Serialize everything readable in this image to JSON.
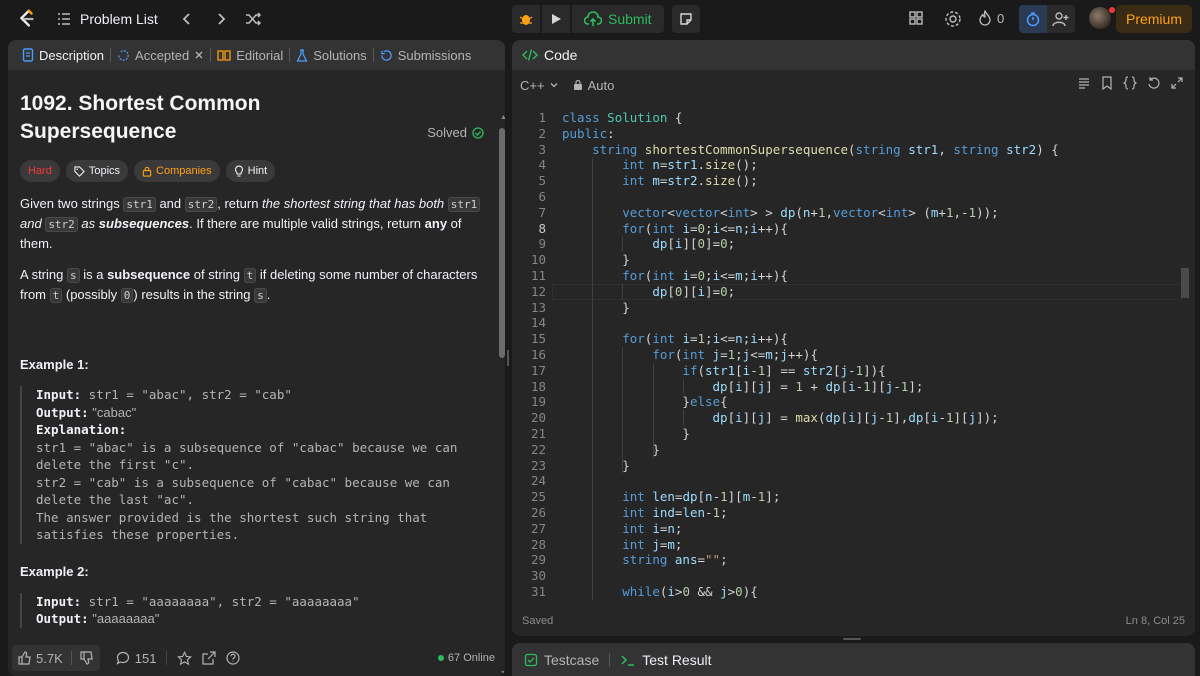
{
  "topbar": {
    "problem_list": "Problem List",
    "submit": "Submit",
    "streak": "0",
    "premium": "Premium"
  },
  "left_tabs": [
    "Description",
    "Accepted",
    "Editorial",
    "Solutions",
    "Submissions"
  ],
  "problem": {
    "title": "1092. Shortest Common Supersequence",
    "solved": "Solved",
    "tags": [
      "Hard",
      "Topics",
      "Companies",
      "Hint"
    ]
  },
  "description": {
    "p1_a": "Given two strings ",
    "p1_code1": "str1",
    "p1_b": " and ",
    "p1_code2": "str2",
    "p1_c": ", return ",
    "p1_em": "the shortest string that has both ",
    "p1_code3": "str1",
    "p1_em2": " and ",
    "p1_code4": "str2",
    "p1_em3": " as ",
    "p1_bold": "subsequences",
    "p1_d": ". If there are multiple valid strings, return ",
    "p1_any": "any",
    "p1_e": " of them.",
    "p2_a": "A string ",
    "p2_s": "s",
    "p2_b": " is a ",
    "p2_bold": "subsequence",
    "p2_c": " of string ",
    "p2_t": "t",
    "p2_d": " if deleting some number of characters from ",
    "p2_t2": "t",
    "p2_e": " (possibly ",
    "p2_zero": "0",
    "p2_f": ") results in the string ",
    "p2_s2": "s",
    "p2_g": "."
  },
  "example1": {
    "heading": "Example 1:",
    "input_label": "Input:",
    "input_value": " str1 = \"abac\", str2 = \"cab\"",
    "output_label": "Output:",
    "output_value": " \"cabac\"",
    "explanation_label": "Explanation:",
    "explanation": "str1 = \"abac\" is a subsequence of \"cabac\" because we can delete the first \"c\".\nstr2 = \"cab\" is a subsequence of \"cabac\" because we can delete the last \"ac\".\nThe answer provided is the shortest such string that satisfies these properties."
  },
  "example2": {
    "heading": "Example 2:",
    "input_label": "Input:",
    "input_value": " str1 = \"aaaaaaaa\", str2 = \"aaaaaaaa\"",
    "output_label": "Output:",
    "output_value": " \"aaaaaaaa\""
  },
  "left_footer": {
    "likes": "5.7K",
    "comments": "151",
    "online": "67 Online"
  },
  "code_panel": {
    "tab": "Code",
    "language": "C++",
    "mode": "Auto",
    "status_left": "Saved",
    "status_right": "Ln 8, Col 25",
    "current_line": 8
  },
  "code_lines": [
    "class Solution {",
    "public:",
    "    string shortestCommonSupersequence(string str1, string str2) {",
    "        int n=str1.size();",
    "        int m=str2.size();",
    "",
    "        vector<vector<int> > dp(n+1,vector<int> (m+1,-1));",
    "        for(int i=0;i<=n;i++){",
    "            dp[i][0]=0;",
    "        }",
    "        for(int i=0;i<=m;i++){",
    "            dp[0][i]=0;",
    "        }",
    "",
    "        for(int i=1;i<=n;i++){",
    "            for(int j=1;j<=m;j++){",
    "                if(str1[i-1] == str2[j-1]){",
    "                    dp[i][j] = 1 + dp[i-1][j-1];",
    "                }else{",
    "                    dp[i][j] = max(dp[i][j-1],dp[i-1][j]);",
    "                }",
    "            }",
    "        }",
    "",
    "        int len=dp[n-1][m-1];",
    "        int ind=len-1;",
    "        int i=n;",
    "        int j=m;",
    "        string ans=\"\";",
    "",
    "        while(i>0 && j>0){"
  ],
  "bottom_tabs": [
    "Testcase",
    "Test Result"
  ],
  "colors": {
    "accent_green": "#2cbb5d",
    "brand_orange": "#ffa116",
    "hard_red": "#f63737",
    "timer_blue": "#1a73e8"
  },
  "icons": [
    "leetcode-logo",
    "list-icon",
    "chevron-left-icon",
    "chevron-right-icon",
    "shuffle-icon",
    "debug-icon",
    "play-icon",
    "cloud-upload-icon",
    "notes-icon",
    "layout-icon",
    "settings-icon",
    "fire-icon",
    "timer-icon",
    "add-user-icon",
    "avatar"
  ]
}
